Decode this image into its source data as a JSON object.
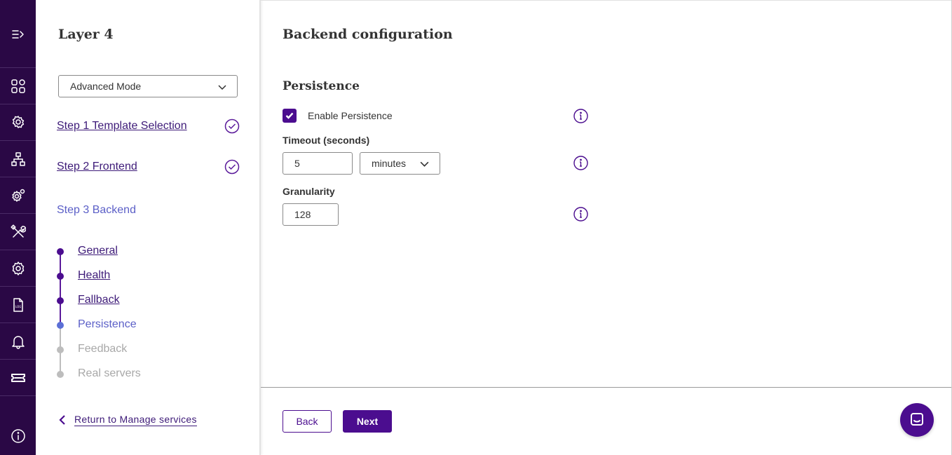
{
  "rail": {
    "items": [
      {
        "icon": "expand-menu-icon"
      },
      {
        "icon": "dashboard-icon"
      },
      {
        "icon": "location-gear-icon"
      },
      {
        "icon": "network-icon"
      },
      {
        "icon": "settings-gears-icon"
      },
      {
        "icon": "tools-icon"
      },
      {
        "icon": "gear-icon"
      },
      {
        "icon": "log-file-icon"
      },
      {
        "icon": "bell-icon"
      },
      {
        "icon": "ticket-icon"
      },
      {
        "icon": "info-icon"
      }
    ]
  },
  "panel": {
    "title": "Layer 4",
    "mode_select": "Advanced Mode",
    "steps": [
      {
        "label": "Step 1 Template Selection",
        "state": "completed"
      },
      {
        "label": "Step 2 Frontend",
        "state": "completed"
      },
      {
        "label": "Step 3 Backend",
        "state": "active"
      }
    ],
    "substeps": [
      {
        "label": "General",
        "state": "done"
      },
      {
        "label": "Health",
        "state": "done"
      },
      {
        "label": "Fallback",
        "state": "done"
      },
      {
        "label": "Persistence",
        "state": "active"
      },
      {
        "label": "Feedback",
        "state": "todo"
      },
      {
        "label": "Real servers",
        "state": "todo"
      }
    ],
    "return_link": "Return to Manage services"
  },
  "main": {
    "title": "Backend configuration",
    "section_title": "Persistence",
    "enable_persistence": {
      "label": "Enable Persistence",
      "checked": true
    },
    "timeout": {
      "label": "Timeout (seconds)",
      "value": "5",
      "unit": "minutes"
    },
    "granularity": {
      "label": "Granularity",
      "value": "128"
    }
  },
  "footer": {
    "back_label": "Back",
    "next_label": "Next"
  },
  "colors": {
    "rail_bg": "#2a0845",
    "accent": "#4b0d8f",
    "active_step": "#5b5fc7",
    "inactive": "#a8a8a8"
  }
}
